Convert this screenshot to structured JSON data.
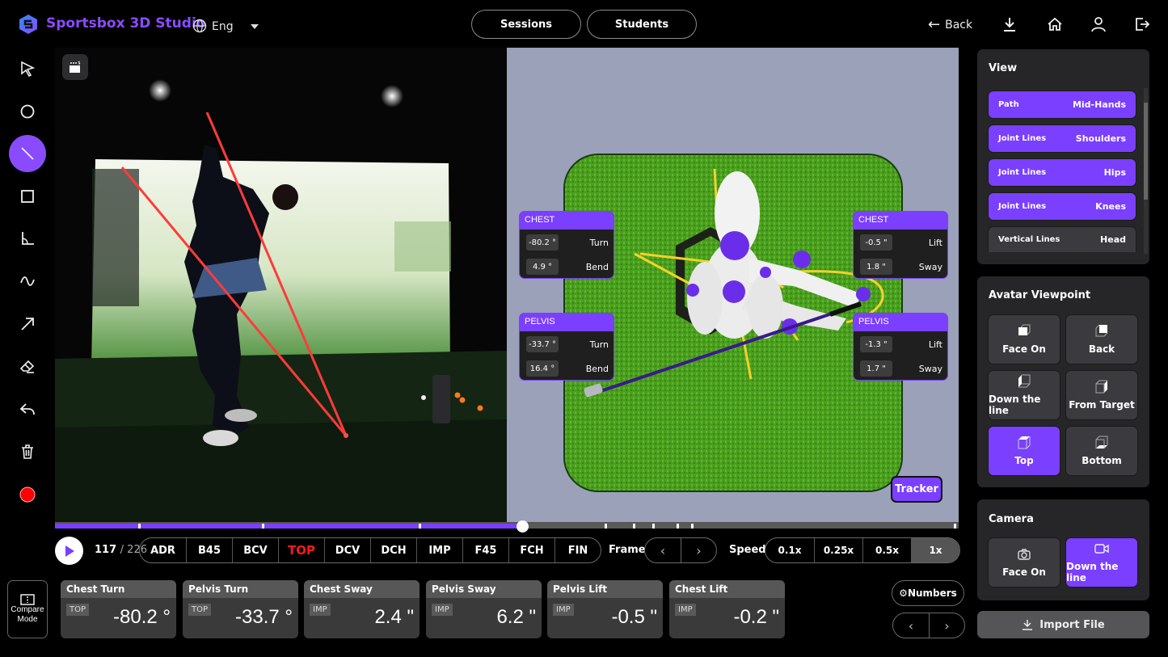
{
  "header": {
    "brand": "Sportsbox 3D Studio",
    "language": "Eng",
    "nav": [
      "Sessions",
      "Students"
    ],
    "back_label": "Back",
    "icons": [
      "download-icon",
      "home-icon",
      "user-icon",
      "logout-icon"
    ]
  },
  "toolbar": {
    "tools": [
      "select-arrow",
      "circle",
      "line",
      "rectangle",
      "angle",
      "curve",
      "arrow",
      "eraser",
      "undo",
      "delete",
      "record"
    ],
    "active_tool": "line"
  },
  "avatar_metrics": {
    "chest_left": {
      "title": "CHEST",
      "rows": [
        {
          "value": "-80.2 °",
          "label": "Turn"
        },
        {
          "value": "4.9 °",
          "label": "Bend"
        }
      ]
    },
    "pelvis_left": {
      "title": "PELVIS",
      "rows": [
        {
          "value": "-33.7 °",
          "label": "Turn"
        },
        {
          "value": "16.4 °",
          "label": "Bend"
        }
      ]
    },
    "chest_right": {
      "title": "CHEST",
      "rows": [
        {
          "value": "-0.5 \"",
          "label": "Lift"
        },
        {
          "value": "1.8 \"",
          "label": "Sway"
        }
      ]
    },
    "pelvis_right": {
      "title": "PELVIS",
      "rows": [
        {
          "value": "-1.3 \"",
          "label": "Lift"
        },
        {
          "value": "1.7 \"",
          "label": "Sway"
        }
      ]
    },
    "tracker_label": "Tracker"
  },
  "playback": {
    "current_frame": "117",
    "total_frames": "/ 226",
    "progress": 0.517,
    "phases": [
      "ADR",
      "B45",
      "BCV",
      "TOP",
      "DCV",
      "DCH",
      "IMP",
      "F45",
      "FCH",
      "FIN"
    ],
    "active_phase": "TOP",
    "frame_label": "Frame",
    "speed_label": "Speed",
    "speeds": [
      "0.1x",
      "0.25x",
      "0.5x",
      "1x"
    ],
    "active_speed": "1x"
  },
  "compare_mode": {
    "line1": "Compare",
    "line2": "Mode"
  },
  "stats": [
    {
      "title": "Chest Turn",
      "phase": "TOP",
      "value": "-80.2 °"
    },
    {
      "title": "Pelvis Turn",
      "phase": "TOP",
      "value": "-33.7 °"
    },
    {
      "title": "Chest Sway",
      "phase": "IMP",
      "value": "2.4 \""
    },
    {
      "title": "Pelvis Sway",
      "phase": "IMP",
      "value": "6.2 \""
    },
    {
      "title": "Pelvis Lift",
      "phase": "IMP",
      "value": "-0.5 \""
    },
    {
      "title": "Chest Lift",
      "phase": "IMP",
      "value": "-0.2 \""
    }
  ],
  "numbers_label": "Numbers",
  "view_panel": {
    "title": "View",
    "items": [
      {
        "key": "Path",
        "value": "Mid-Hands",
        "on": true
      },
      {
        "key": "Joint Lines",
        "value": "Shoulders",
        "on": true
      },
      {
        "key": "Joint Lines",
        "value": "Hips",
        "on": true
      },
      {
        "key": "Joint Lines",
        "value": "Knees",
        "on": true
      },
      {
        "key": "Vertical Lines",
        "value": "Head",
        "on": false
      }
    ]
  },
  "avatar_viewpoint": {
    "title": "Avatar Viewpoint",
    "options": [
      "Face On",
      "Back",
      "Down the line",
      "From Target",
      "Top",
      "Bottom"
    ],
    "active": "Top"
  },
  "camera": {
    "title": "Camera",
    "options": [
      "Face On",
      "Down the line"
    ],
    "active": "Down the line"
  },
  "import_label": "Import File",
  "colors": {
    "accent": "#7b3fff",
    "brand": "#8a4bff",
    "active_phase": "#ff1a1a",
    "record": "#ff0000"
  }
}
